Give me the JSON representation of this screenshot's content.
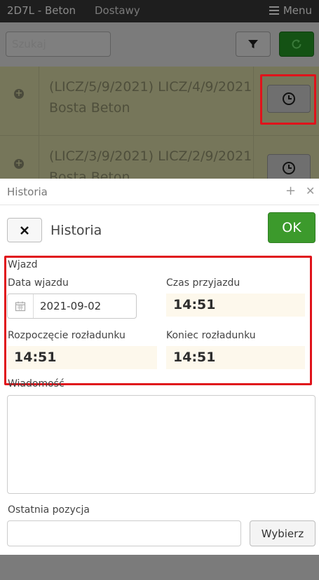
{
  "app": {
    "title": "2D7L - Beton",
    "tab": "Dostawy",
    "menu_label": "Menu"
  },
  "toolbar": {
    "search_placeholder": "Szukaj"
  },
  "list": {
    "rows": [
      {
        "line1": "(LICZ/5/9/2021) LICZ/4/9/2021",
        "line2": "Bosta Beton"
      },
      {
        "line1": "(LICZ/3/9/2021) LICZ/2/9/2021",
        "line2": "Bosta Beton"
      }
    ]
  },
  "dialog": {
    "title": "Historia",
    "panel_title": "Historia",
    "ok_label": "OK",
    "section_label": "Wjazd",
    "date_label": "Data wjazdu",
    "date_value": "2021-09-02",
    "arrival_time_label": "Czas przyjazdu",
    "arrival_time_value": "14:51",
    "unload_start_label": "Rozpoczęcie rozładunku",
    "unload_start_value": "14:51",
    "unload_end_label": "Koniec rozładunku",
    "unload_end_value": "14:51",
    "message_label": "Wiadomość",
    "last_position_label": "Ostatnia pozycja",
    "choose_label": "Wybierz"
  },
  "icons": {
    "menu": "hamburger-icon",
    "filter": "filter-icon",
    "refresh": "refresh-icon",
    "expand": "plus-circle-icon",
    "history": "clock-icon",
    "calendar": "calendar-icon",
    "close": "close-icon"
  },
  "colors": {
    "ok_button": "#3c9a2c",
    "highlight_border": "#e0131b",
    "time_field_bg": "#fdf8ec"
  }
}
